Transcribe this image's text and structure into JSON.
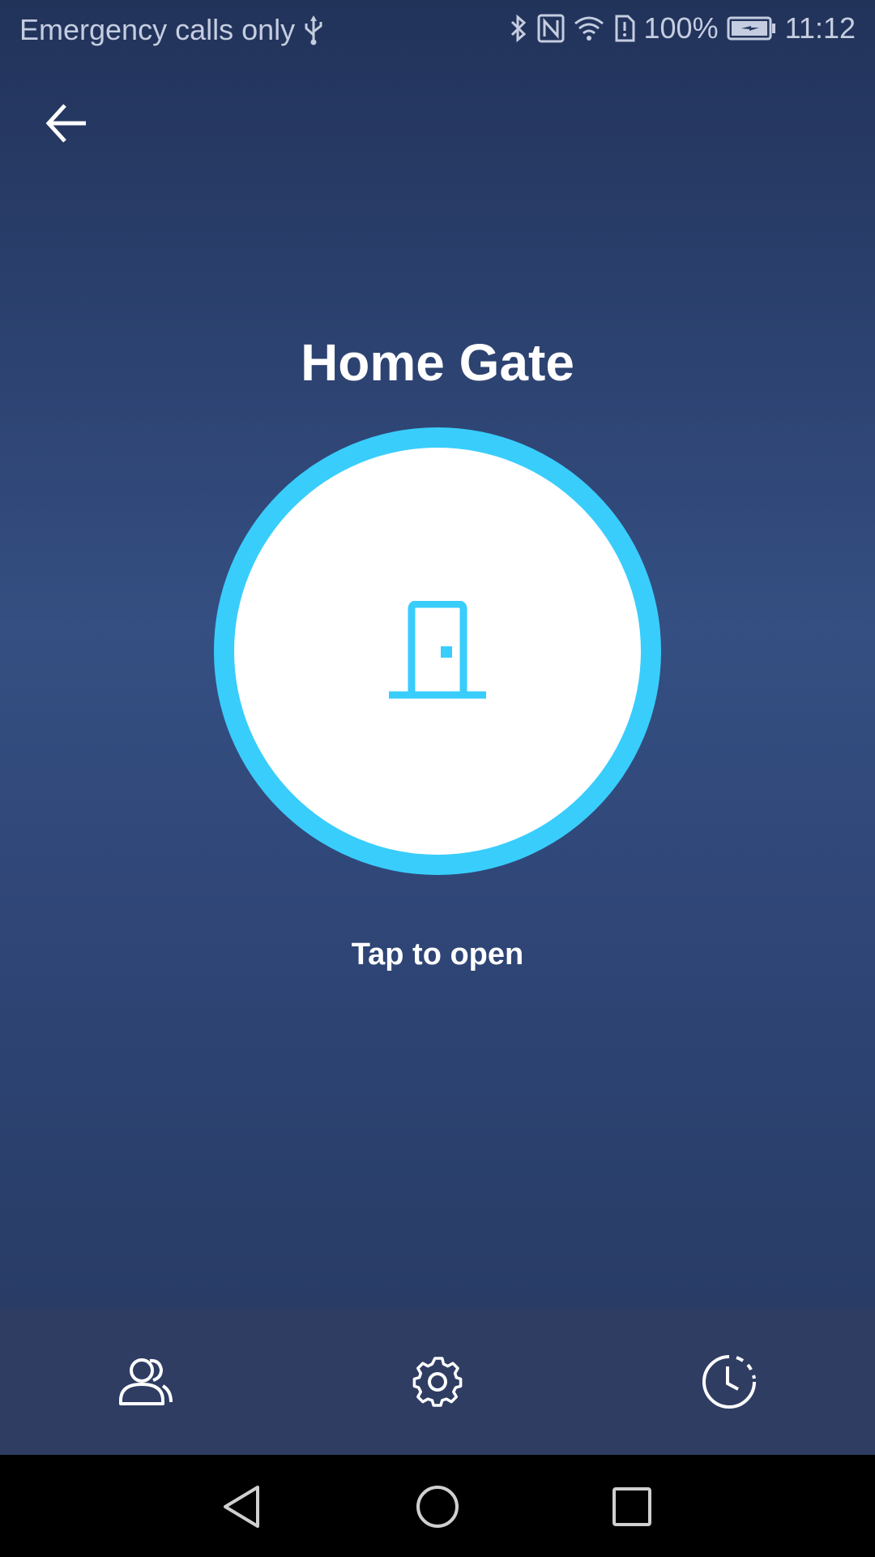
{
  "status_bar": {
    "carrier_text": "Emergency calls only",
    "battery_percent": "100%",
    "time": "11:12",
    "icons": [
      "usb-icon",
      "bluetooth-icon",
      "nfc-icon",
      "wifi-icon",
      "sim-alert-icon",
      "battery-charging-icon"
    ]
  },
  "header": {
    "back_icon": "arrow-left-icon"
  },
  "device": {
    "name": "Home Gate",
    "action_icon": "door-icon",
    "hint": "Tap to open"
  },
  "toolbar": {
    "items": [
      {
        "icon": "users-icon"
      },
      {
        "icon": "gear-icon"
      },
      {
        "icon": "history-clock-icon"
      }
    ]
  },
  "nav_bar": {
    "icons": [
      "back-triangle-icon",
      "home-circle-icon",
      "recents-square-icon"
    ]
  },
  "colors": {
    "accent": "#39cdfc",
    "background_top": "#22335a",
    "background_mid": "#354f82",
    "toolbar": "#2f3d63",
    "text": "#ffffff"
  }
}
